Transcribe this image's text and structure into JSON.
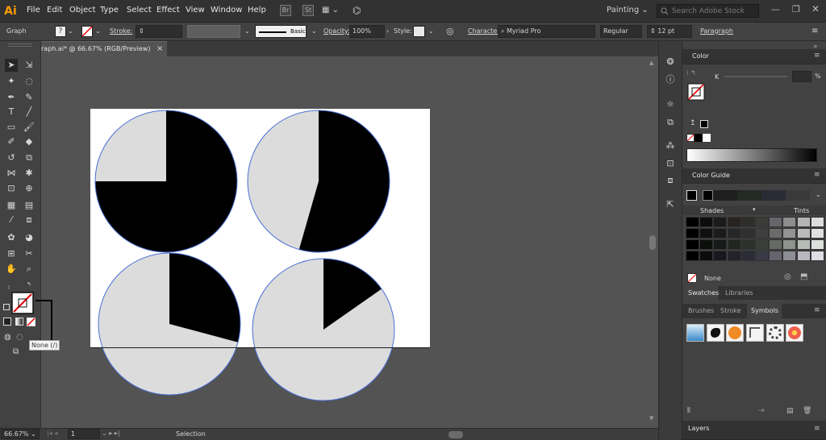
{
  "app": {
    "logo": "Ai",
    "menu": [
      "File",
      "Edit",
      "Object",
      "Type",
      "Select",
      "Effect",
      "View",
      "Window",
      "Help"
    ],
    "toolbar_icons": [
      "Br",
      "St",
      "▦ ⌄",
      "⌬"
    ],
    "workspace": "Painting",
    "search_placeholder": "Search Adobe Stock"
  },
  "control_bar": {
    "selection_type": "Graph",
    "stroke_label": "Stroke:",
    "brush": "Basic",
    "opacity_label": "Opacity:",
    "opacity_value": "100%",
    "style_label": "Style:",
    "character_label": "Character:",
    "font_family": "Myriad Pro",
    "font_style": "Regular",
    "font_size": "12 pt",
    "paragraph_label": "Paragraph"
  },
  "document": {
    "tab_title": "raph.ai* @ 66.67% (RGB/Preview)",
    "close_glyph": "×"
  },
  "toolbox": {
    "tooltip": "None (/)"
  },
  "pies": [
    {
      "shaded_start_deg": 0,
      "shaded_end_deg": 270,
      "colors": {
        "shaded": "#000000",
        "rest": "#dcdcdc"
      }
    },
    {
      "shaded_start_deg": 0,
      "shaded_end_deg": 196,
      "colors": {
        "shaded": "#000000",
        "rest": "#dcdcdc"
      }
    },
    {
      "shaded_start_deg": 0,
      "shaded_end_deg": 105,
      "colors": {
        "shaded": "#000000",
        "rest": "#dcdcdc"
      }
    },
    {
      "shaded_start_deg": 0,
      "shaded_end_deg": 55,
      "colors": {
        "shaded": "#000000",
        "rest": "#dcdcdc"
      }
    }
  ],
  "status_bar": {
    "zoom": "66.67%",
    "page": "1",
    "tool": "Selection"
  },
  "color_panel": {
    "title": "Color",
    "channel": "K",
    "percent_label": "%"
  },
  "color_guide_panel": {
    "title": "Color Guide",
    "shades_label": "Shades",
    "tints_label": "Tints",
    "none_label": "None",
    "grid_colors": [
      [
        "#000000",
        "#0d0d0d",
        "#1b1b1b",
        "#262321",
        "#2e2d2a",
        "#3b3b3a",
        "#66666a",
        "#8d8d8d",
        "#b5b5b5",
        "#dcdcdc"
      ],
      [
        "#000000",
        "#0f1110",
        "#1a1c1c",
        "#252627",
        "#2d302e",
        "#3d403e",
        "#6a6c6a",
        "#939393",
        "#bbbcba",
        "#e0e0e0"
      ],
      [
        "#000000",
        "#0c0e0c",
        "#171a17",
        "#222622",
        "#2c312c",
        "#3a4039",
        "#646a64",
        "#8e938d",
        "#b8bcb8",
        "#dee0de"
      ],
      [
        "#000000",
        "#0c0c0f",
        "#17171d",
        "#21222a",
        "#2b2c36",
        "#393a46",
        "#63646f",
        "#8d8e96",
        "#b7b8be",
        "#dedee2"
      ]
    ]
  },
  "swatches_panel": {
    "tabs": [
      "Swatches",
      "Libraries"
    ]
  },
  "symbols_panel": {
    "tabs": [
      "Brushes",
      "Stroke",
      "Symbols"
    ]
  },
  "layers_panel": {
    "title": "Layers"
  }
}
